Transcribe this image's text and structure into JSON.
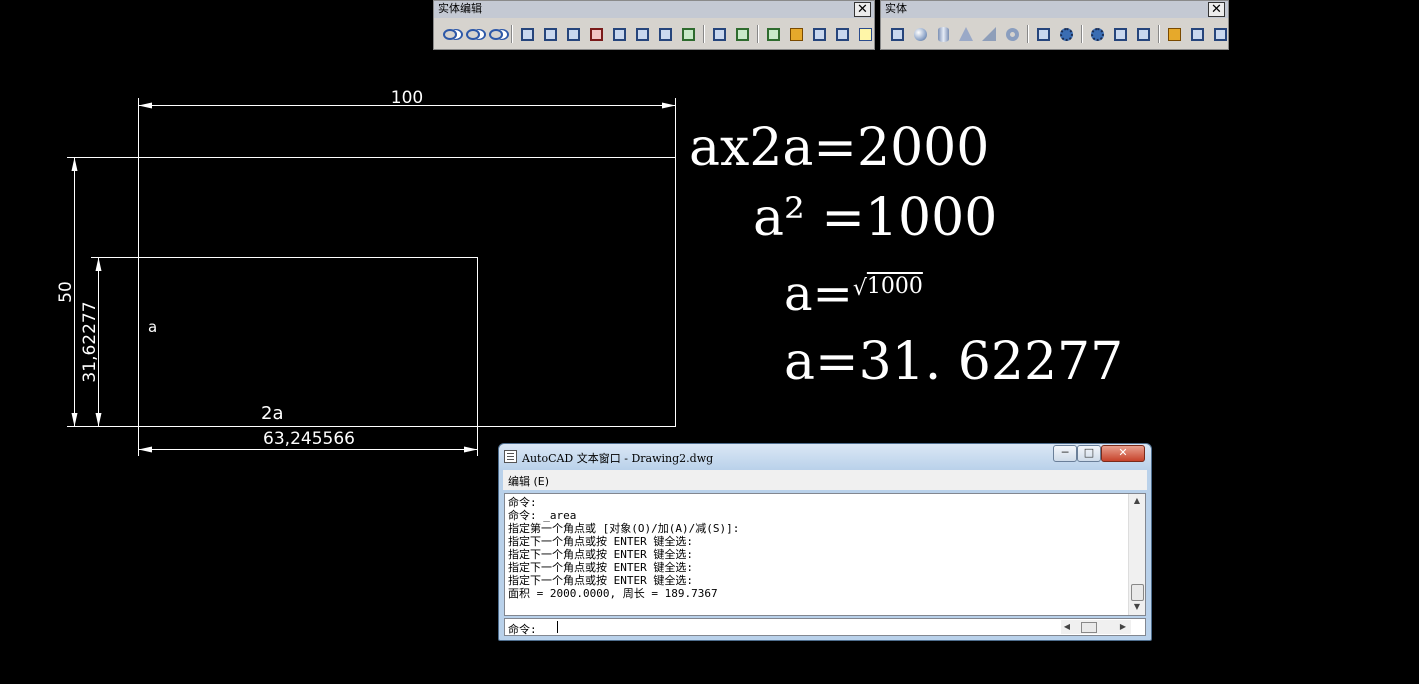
{
  "toolbars": {
    "solid_edit": {
      "title": "实体编辑",
      "close": "✕",
      "icons": [
        "union-icon",
        "subtract-icon",
        "intersect-icon",
        "sep",
        "extrude-faces-icon",
        "move-faces-icon",
        "offset-faces-icon",
        "delete-faces-icon",
        "rotate-faces-icon",
        "taper-faces-icon",
        "copy-faces-icon",
        "color-faces-icon",
        "sep",
        "copy-edges-icon",
        "color-edges-icon",
        "sep",
        "imprint-icon",
        "clean-icon",
        "separate-icon",
        "shell-icon",
        "check-icon"
      ]
    },
    "solid": {
      "title": "实体",
      "close": "✕",
      "icons": [
        "box-icon",
        "sphere-icon",
        "cylinder-icon",
        "cone-icon",
        "wedge-icon",
        "torus-icon",
        "sep",
        "extrude-icon",
        "revolve-icon",
        "sep",
        "slice-icon",
        "section-icon",
        "interfere-icon",
        "sep",
        "setup-drawing-icon",
        "setup-view-icon",
        "setup-profile-icon"
      ]
    }
  },
  "drawing": {
    "dim_top": "100",
    "dim_left_outer": "50",
    "dim_left_inner": "31,62277",
    "dim_bottom": "63,245566",
    "label_a": "a",
    "label_2a": "2a"
  },
  "equations": {
    "eq1": "ax2a=2000",
    "eq2": "a² =1000",
    "eq3_prefix": "a=",
    "eq3_sqrt": "√",
    "eq3_radicand": "1000",
    "eq4": "a=31. 62277"
  },
  "text_window": {
    "title": "AutoCAD 文本窗口 - Drawing2.dwg",
    "menu": "编辑 (E)",
    "buttons": {
      "min": "─",
      "max": "□",
      "close": "✕"
    },
    "lines": [
      "命令:",
      "命令: _area",
      "指定第一个角点或 [对象(O)/加(A)/减(S)]:",
      "指定下一个角点或按 ENTER 键全选:",
      "指定下一个角点或按 ENTER 键全选:",
      "指定下一个角点或按 ENTER 键全选:",
      "指定下一个角点或按 ENTER 键全选:",
      "面积 = 2000.0000, 周长 = 189.7367"
    ],
    "prompt": "命令:",
    "scroll_up": "▲",
    "scroll_down": "▼",
    "scroll_left": "◀",
    "scroll_right": "▶"
  }
}
